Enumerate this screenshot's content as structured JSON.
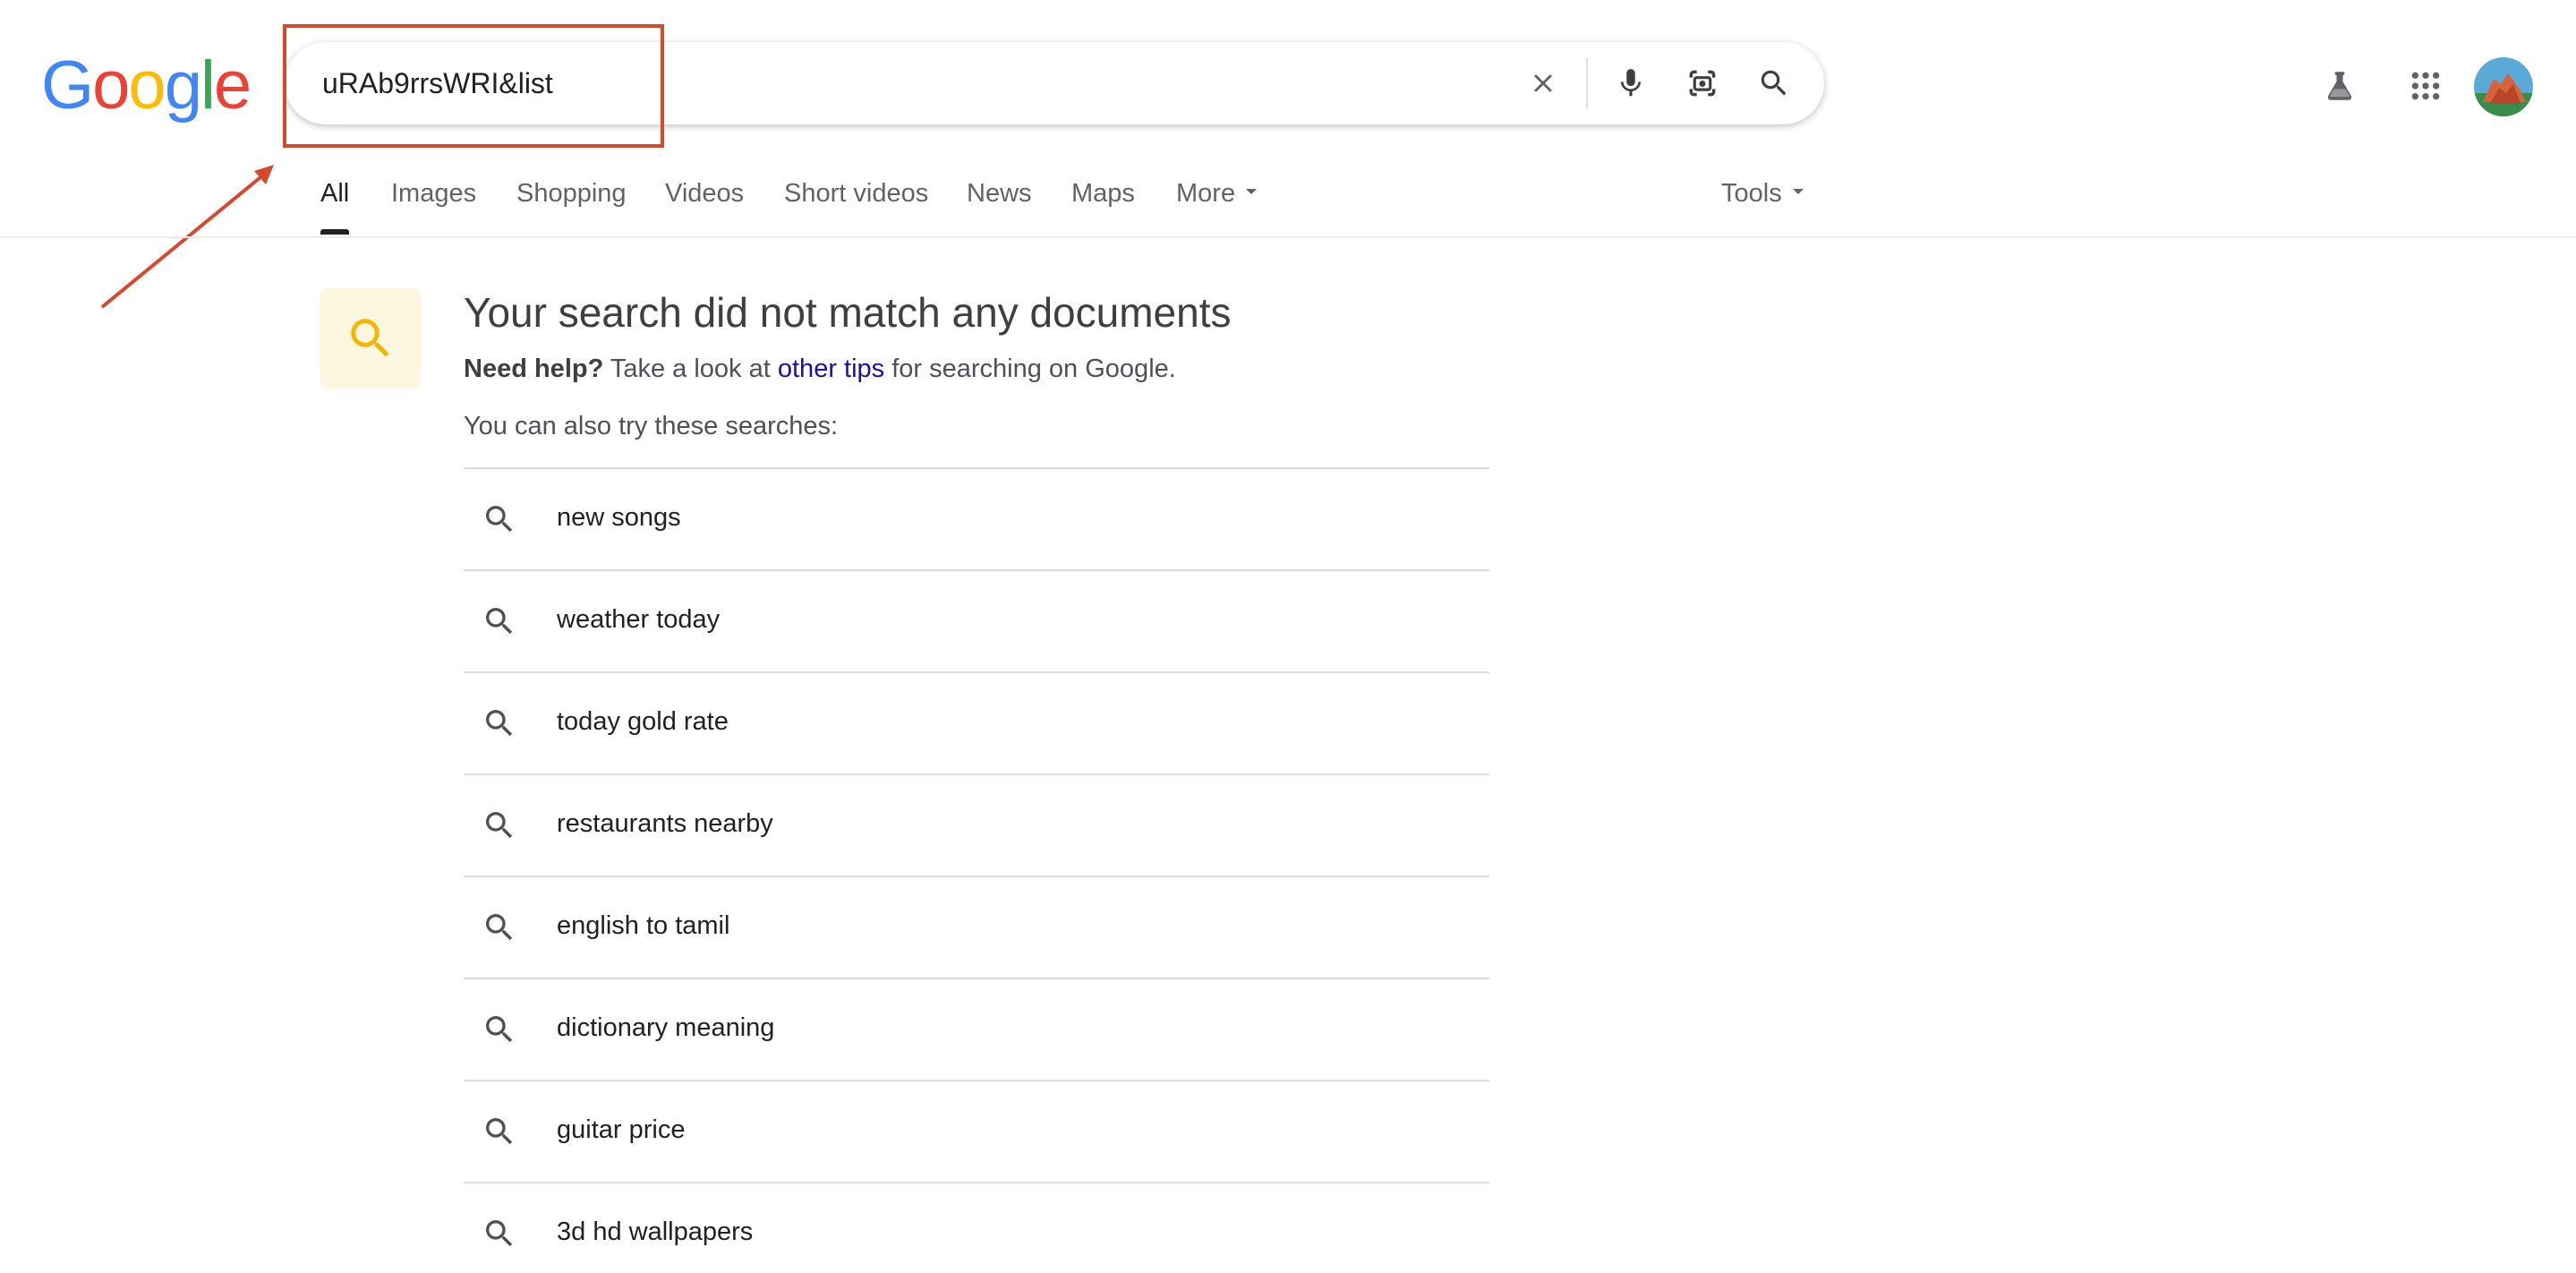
{
  "logo": {
    "letters": [
      "G",
      "o",
      "o",
      "g",
      "l",
      "e"
    ],
    "colors": [
      "#4285f4",
      "#ea4335",
      "#fbbc05",
      "#4285f4",
      "#34a853",
      "#ea4335"
    ]
  },
  "search": {
    "query": "uRAb9rrsWRI&list"
  },
  "tabs": [
    {
      "label": "All"
    },
    {
      "label": "Images"
    },
    {
      "label": "Shopping"
    },
    {
      "label": "Videos"
    },
    {
      "label": "Short videos"
    },
    {
      "label": "News"
    },
    {
      "label": "Maps"
    },
    {
      "label": "More"
    }
  ],
  "tools_label": "Tools",
  "no_results": {
    "headline": "Your search did not match any documents",
    "help_bold": "Need help?",
    "help_pre": "Take a look at",
    "help_link": "other tips",
    "help_post": "for searching on Google.",
    "try_label": "You can also try these searches:"
  },
  "suggestions": [
    "new songs",
    "weather today",
    "today gold rate",
    "restaurants nearby",
    "english to tamil",
    "dictionary meaning",
    "guitar price",
    "3d hd wallpapers"
  ],
  "annotation_color": "#d6492f",
  "accent_colors": {
    "link": "#1a0dab",
    "no_result_bg": "#fef7e0",
    "no_result_icon": "#f4b400"
  }
}
